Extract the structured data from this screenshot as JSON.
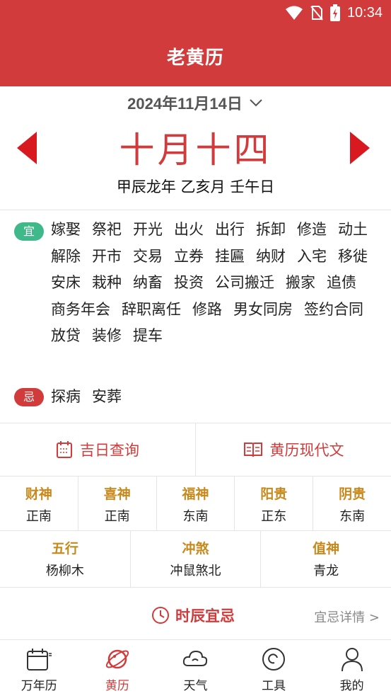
{
  "status_bar": {
    "time": "10:34"
  },
  "header": {
    "title": "老黄历"
  },
  "date_selector": {
    "date": "2024年11月14日"
  },
  "lunar": {
    "date": "十月十四",
    "ganzhi": "甲辰龙年 乙亥月 壬午日"
  },
  "yi": {
    "badge": "宜",
    "items": [
      "嫁娶",
      "祭祀",
      "开光",
      "出火",
      "出行",
      "拆卸",
      "修造",
      "动土",
      "解除",
      "开市",
      "交易",
      "立券",
      "挂匾",
      "纳财",
      "入宅",
      "移徙",
      "安床",
      "栽种",
      "纳畜",
      "投资",
      "公司搬迁",
      "搬家",
      "追债",
      "商务年会",
      "辞职离任",
      "修路",
      "男女同房",
      "签约合同",
      "放贷",
      "装修",
      "提车"
    ]
  },
  "ji": {
    "badge": "忌",
    "items": [
      "探病",
      "安葬"
    ]
  },
  "links": {
    "lucky_day": "吉日查询",
    "modern_text": "黄历现代文"
  },
  "gods": [
    {
      "title": "财神",
      "value": "正南"
    },
    {
      "title": "喜神",
      "value": "正南"
    },
    {
      "title": "福神",
      "value": "东南"
    },
    {
      "title": "阳贵",
      "value": "正东"
    },
    {
      "title": "阴贵",
      "value": "东南"
    }
  ],
  "info": [
    {
      "title": "五行",
      "value": "杨柳木"
    },
    {
      "title": "冲煞",
      "value": "冲鼠煞北"
    },
    {
      "title": "值神",
      "value": "青龙"
    }
  ],
  "hours": {
    "title": "时辰宜忌",
    "detail": "宜忌详情 >"
  },
  "tabs": [
    {
      "label": "万年历",
      "icon": "calendar-icon",
      "active": false
    },
    {
      "label": "黄历",
      "icon": "planet-icon",
      "active": true
    },
    {
      "label": "天气",
      "icon": "cloud-icon",
      "active": false
    },
    {
      "label": "工具",
      "icon": "tool-icon",
      "active": false
    },
    {
      "label": "我的",
      "icon": "user-icon",
      "active": false
    }
  ],
  "colors": {
    "primary": "#d23b3b",
    "gold": "#c8891c",
    "yi_green": "#3fb88a"
  }
}
